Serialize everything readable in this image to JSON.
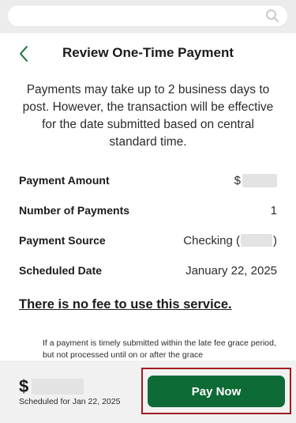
{
  "header": {
    "title": "Review One-Time Payment"
  },
  "notice": "Payments may take up to 2 business days to post. However, the transaction will be effective for the date submitted based on central standard time.",
  "details": {
    "payment_amount": {
      "label": "Payment Amount",
      "value": "$"
    },
    "number_of_payments": {
      "label": "Number of Payments",
      "value": "1"
    },
    "payment_source": {
      "label": "Payment Source",
      "value_prefix": "Checking (",
      "value_suffix": ")"
    },
    "scheduled_date": {
      "label": "Scheduled Date",
      "value": "January 22, 2025"
    }
  },
  "fee_notice": "There is no fee to use this service.",
  "fine_print": "If a payment is timely submitted within the late fee grace period, but not processed until on or after the grace",
  "footer": {
    "amount_prefix": "$",
    "scheduled_text": "Scheduled for Jan 22, 2025",
    "pay_label": "Pay Now"
  },
  "colors": {
    "accent": "#0e6b35",
    "highlight_border": "#a31a22"
  }
}
